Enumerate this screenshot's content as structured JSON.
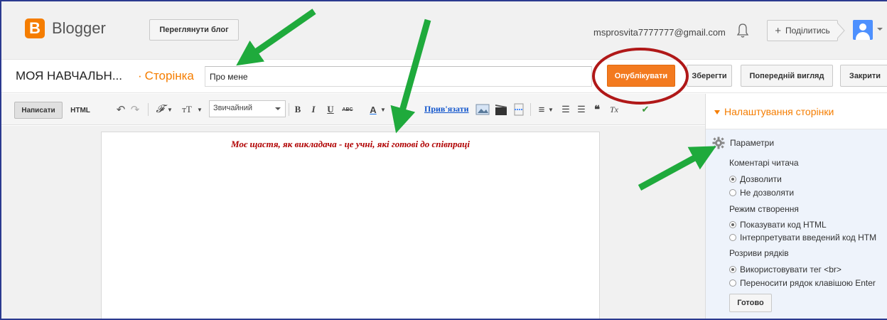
{
  "header": {
    "app_name": "Blogger",
    "view_blog_label": "Переглянути блог",
    "email": "msprosvita7777777@gmail.com",
    "share_label": "Поділитись",
    "share_plus": "+"
  },
  "post": {
    "blog_name": "МОЯ НАВЧАЛЬН...",
    "page_type": "Сторінка",
    "title_value": "Про мене"
  },
  "actions": {
    "publish": "Опублікувати",
    "save": "Зберегти",
    "preview": "Попередній вигляд",
    "close": "Закрити"
  },
  "toolbar": {
    "mode_write": "Написати",
    "mode_html": "HTML",
    "undo": "↶",
    "redo": "↷",
    "font": "𝓕",
    "font_size": "тT",
    "format_value": "Звичайний",
    "bold": "B",
    "italic": "I",
    "underline": "U",
    "strike": "ABC",
    "text_color": "A",
    "link": "Прив'язати",
    "align": "≡",
    "numbered": "☰",
    "bulleted": "☰",
    "quote": "❝",
    "clear": "Tx",
    "check": "✔"
  },
  "editor": {
    "content": "Моє щастя, як викладача - це учні, які готові до співпраці"
  },
  "settings": {
    "heading": "Налаштування сторінки",
    "section_title": "Параметри",
    "comments_label": "Коментарі читача",
    "comments_options": [
      "Дозволити",
      "Не дозволяти"
    ],
    "compose_label": "Режим створення",
    "compose_options": [
      "Показувати код HTML",
      "Інтерпретувати введений код HTM"
    ],
    "linebreak_label": "Розриви рядків",
    "linebreak_options": [
      "Використовувати тег <br>",
      "Переносити рядок клавішою Enter"
    ],
    "done_label": "Готово"
  },
  "colors": {
    "brand_orange": "#f57d00",
    "publish_orange": "#f37a1f",
    "annotation_green": "#1faa3c",
    "annotation_red": "#b01818",
    "editor_text": "#b00000"
  }
}
